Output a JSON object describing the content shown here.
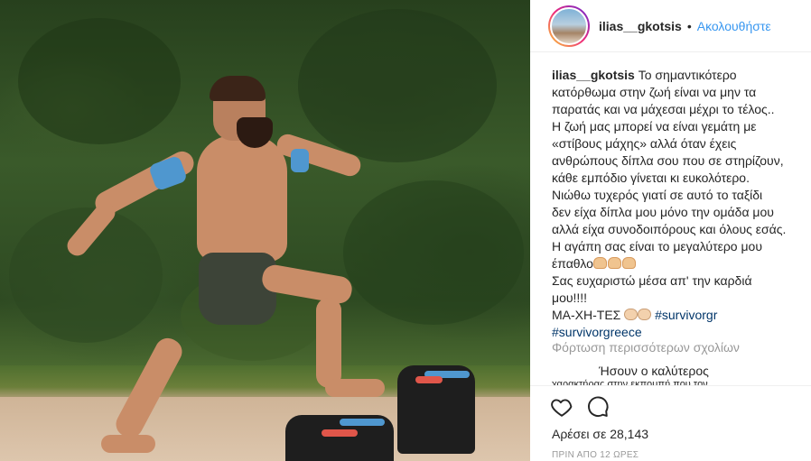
{
  "post": {
    "username": "ilias__gkotsis",
    "follow_label": "Ακολουθήστε",
    "separator": "•",
    "caption_lines": [
      "Το σημαντικότερο",
      "κατόρθωμα στην ζωή είναι να μην τα",
      "παρατάς και να μάχεσαι μέχρι το τέλος..",
      "Η ζωή μας μπορεί να είναι γεμάτη με",
      "«στίβους μάχης» αλλά όταν έχεις",
      "ανθρώπους δίπλα σου που σε στηρίζουν,",
      "κάθε εμπόδιο γίνεται κι ευκολότερο.",
      "Νιώθω τυχερός γιατί σε αυτό το ταξίδι",
      "δεν είχα δίπλα μου μόνο την ομάδα μου",
      "αλλά είχα συνοδοιπόρους και όλους εσάς.",
      "Η αγάπη σας είναι το μεγαλύτερο μου",
      "έπαθλο",
      "Σας ευχαριστώ μέσα απ' την καρδιά",
      "μου!!!!",
      "ΜΑ-ΧΗ-ΤΕΣ"
    ],
    "hashtags": [
      "#survivorgr",
      "#survivorgreece"
    ],
    "load_more": "Φόρτωση περισσότερων σχολίων",
    "comment_preview": "Ήσουν ο καλύτερος",
    "comment_clipped": "χαρακτήρας στην εκπομπή που τον",
    "likes": "Αρέσει σε 28,143",
    "timestamp": "ΠΡΙΝ ΑΠΟ 12 ΩΡΕΣ"
  },
  "icons": {
    "like": "heart-icon",
    "comment": "speech-bubble-icon"
  },
  "colors": {
    "link": "#3897f0",
    "hashtag": "#003569",
    "muted": "#999999"
  }
}
